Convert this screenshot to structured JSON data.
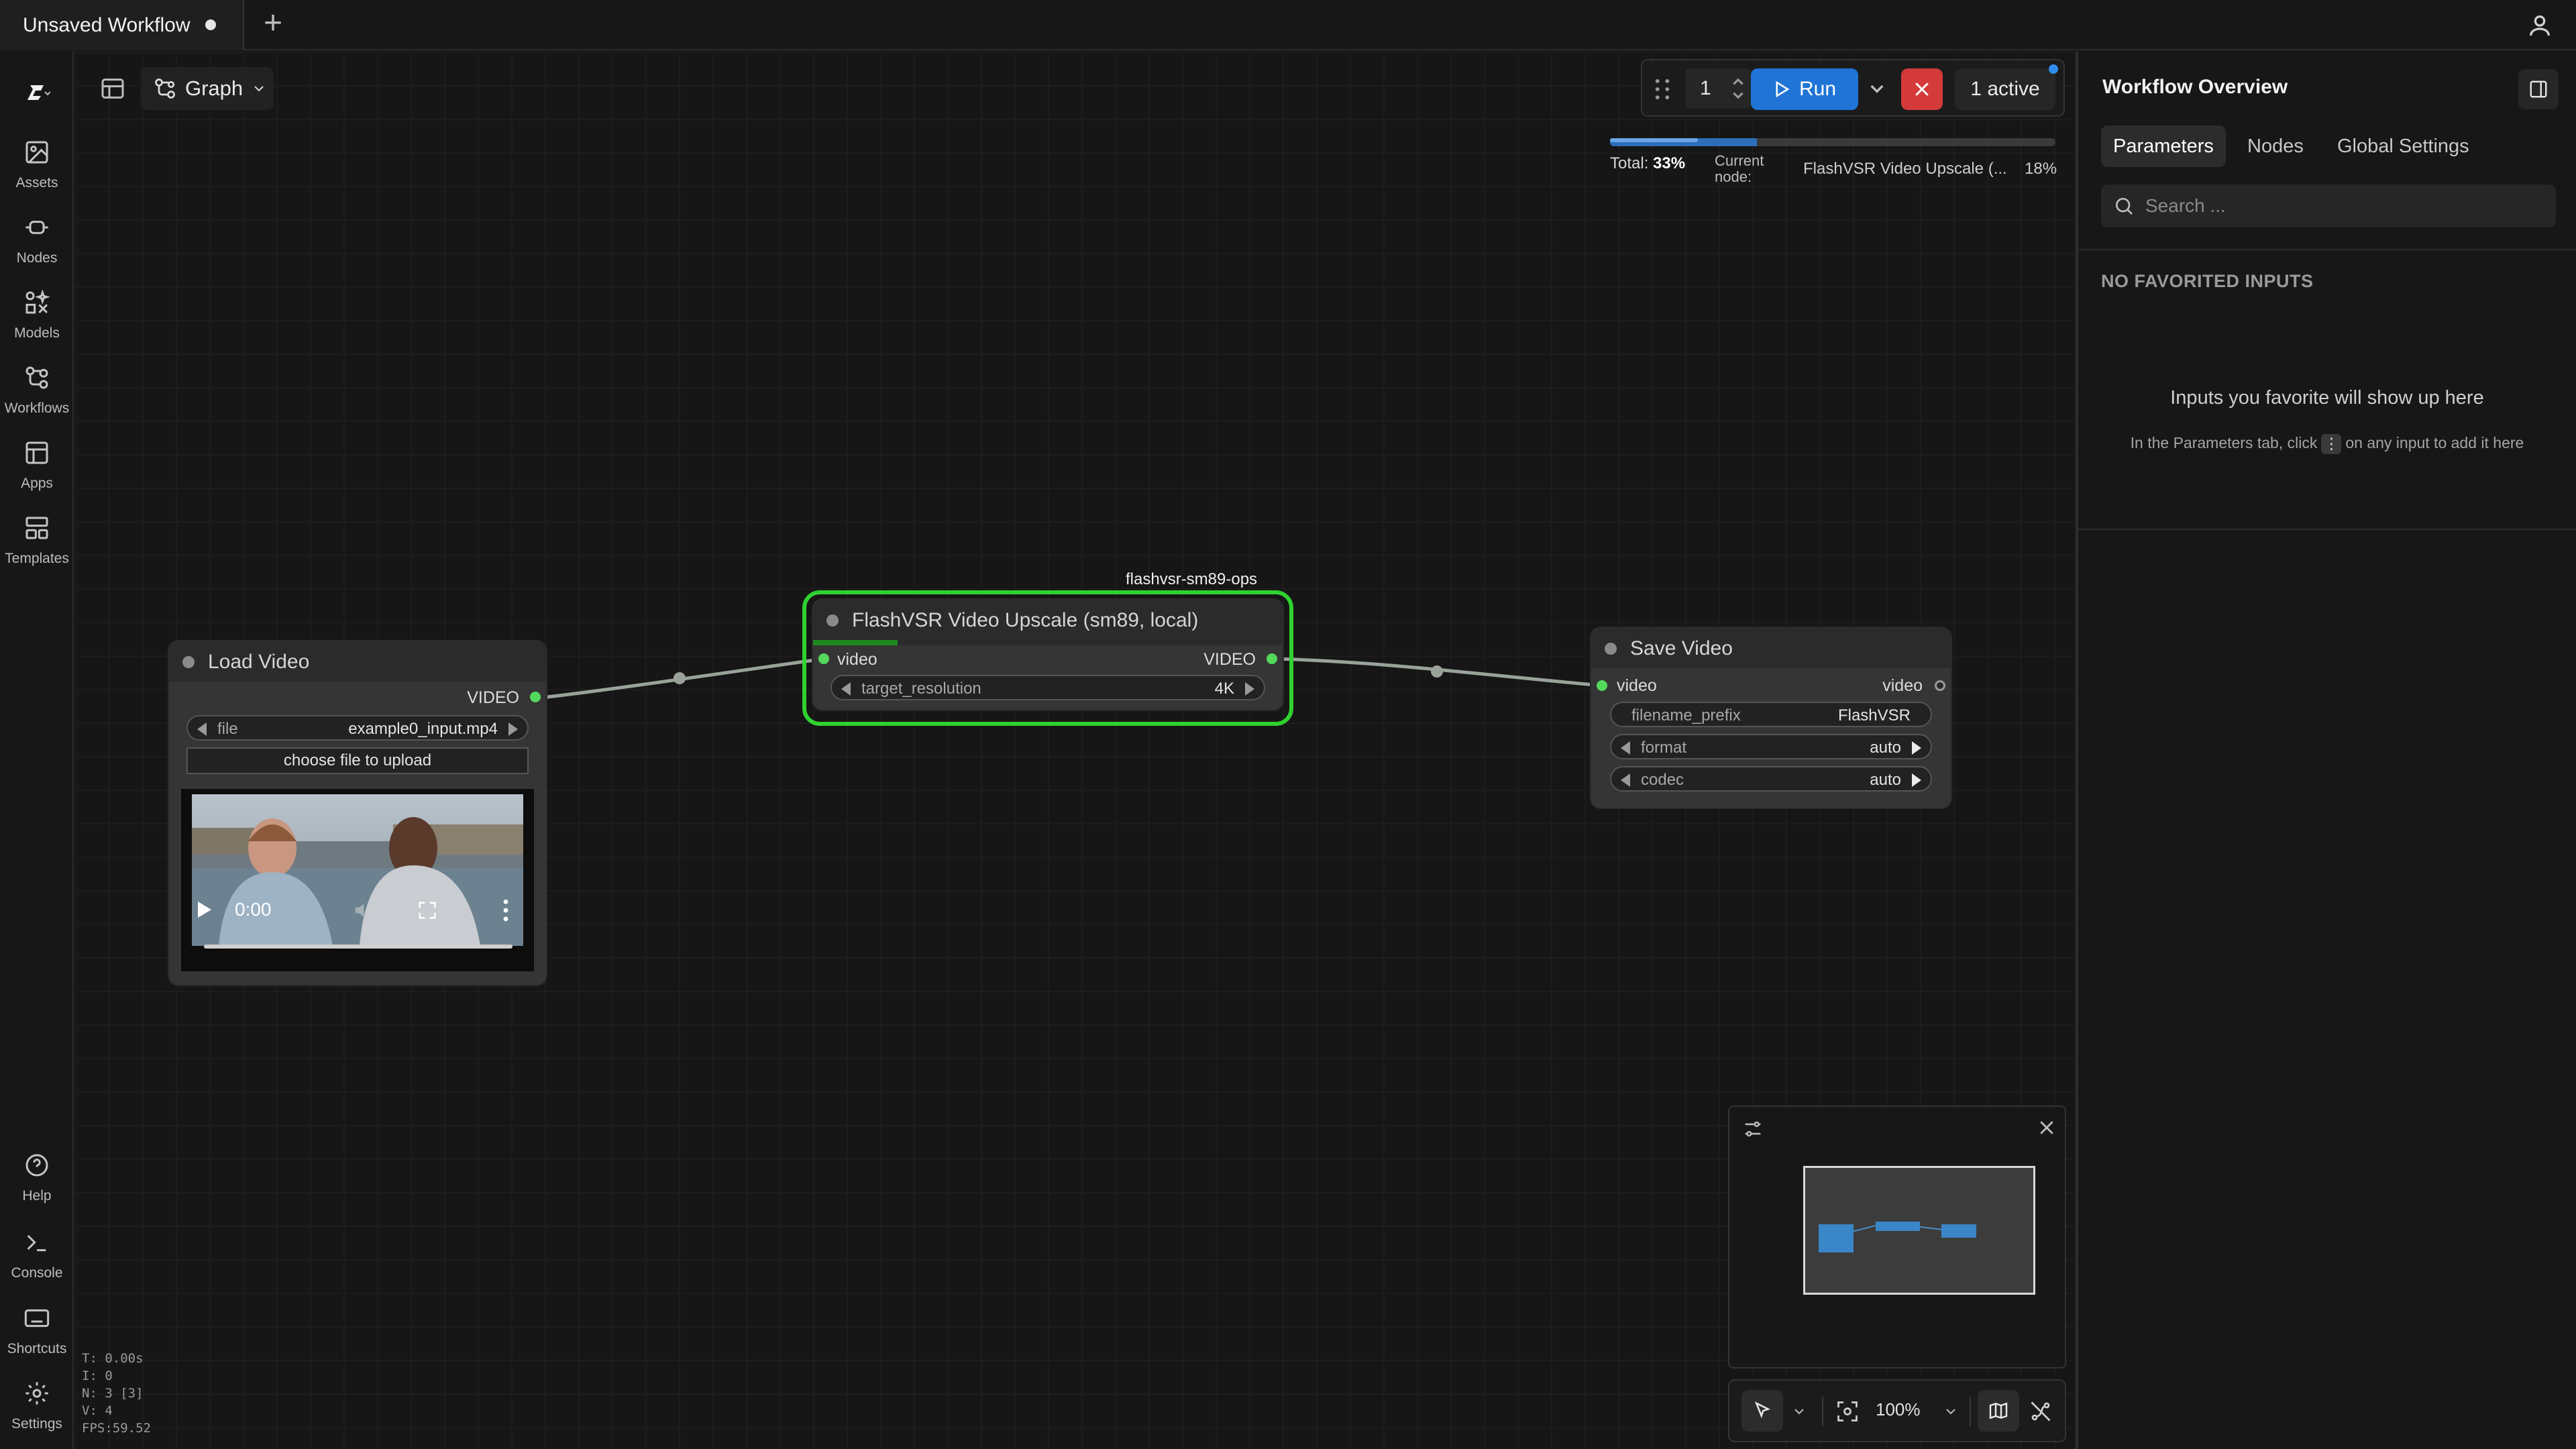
{
  "tabs": [
    {
      "label": "Unsaved Workflow",
      "unsaved": true
    }
  ],
  "sidebar": {
    "items": [
      {
        "label": "Assets",
        "icon": "image-icon"
      },
      {
        "label": "Nodes",
        "icon": "node-icon"
      },
      {
        "label": "Models",
        "icon": "models-icon"
      },
      {
        "label": "Workflows",
        "icon": "workflow-icon"
      },
      {
        "label": "Apps",
        "icon": "apps-icon"
      },
      {
        "label": "Templates",
        "icon": "templates-icon"
      }
    ],
    "bottom_items": [
      {
        "label": "Help",
        "icon": "help-icon"
      },
      {
        "label": "Console",
        "icon": "console-icon"
      },
      {
        "label": "Shortcuts",
        "icon": "keyboard-icon"
      },
      {
        "label": "Settings",
        "icon": "gear-icon"
      }
    ]
  },
  "toolbar": {
    "view_mode": "Graph"
  },
  "runbar": {
    "batch_count": "1",
    "run_label": "Run",
    "queue_label": "1 active"
  },
  "progress": {
    "total_label": "Total:",
    "total_value": "33%",
    "total_fraction": 0.33,
    "current_label": "Current node:",
    "current_node": "FlashVSR Video Upscale (...",
    "current_value": "18%",
    "current_fraction": 0.18
  },
  "nodes": {
    "load_video": {
      "title": "Load Video",
      "output": "VIDEO",
      "file_label": "file",
      "file_value": "example0_input.mp4",
      "upload_label": "choose file to upload",
      "player_time": "0:00"
    },
    "flashvsr": {
      "title": "FlashVSR Video Upscale (sm89, local)",
      "badge": "flashvsr-sm89-ops",
      "input": "video",
      "output": "VIDEO",
      "widget_label": "target_resolution",
      "widget_value": "4K"
    },
    "save_video": {
      "title": "Save Video",
      "input": "video",
      "output": "video",
      "prefix_label": "filename_prefix",
      "prefix_value": "FlashVSR",
      "format_label": "format",
      "format_value": "auto",
      "codec_label": "codec",
      "codec_value": "auto"
    }
  },
  "panel": {
    "title": "Workflow Overview",
    "tabs": [
      "Parameters",
      "Nodes",
      "Global Settings"
    ],
    "search_placeholder": "Search ...",
    "empty_heading": "NO FAVORITED INPUTS",
    "empty_text": "Inputs you favorite will show up here",
    "hint_before": "In the Parameters tab, click",
    "hint_after": "on any input to add it here"
  },
  "canvas_controls": {
    "zoom": "100%"
  },
  "stats": [
    "T: 0.00s",
    "I: 0",
    "N: 3 [3]",
    "V: 4",
    "FPS:59.52"
  ],
  "colors": {
    "accent": "#1f74d6",
    "danger": "#d43a3a",
    "running_border": "#2fd22f",
    "socket": "#54d85c"
  }
}
